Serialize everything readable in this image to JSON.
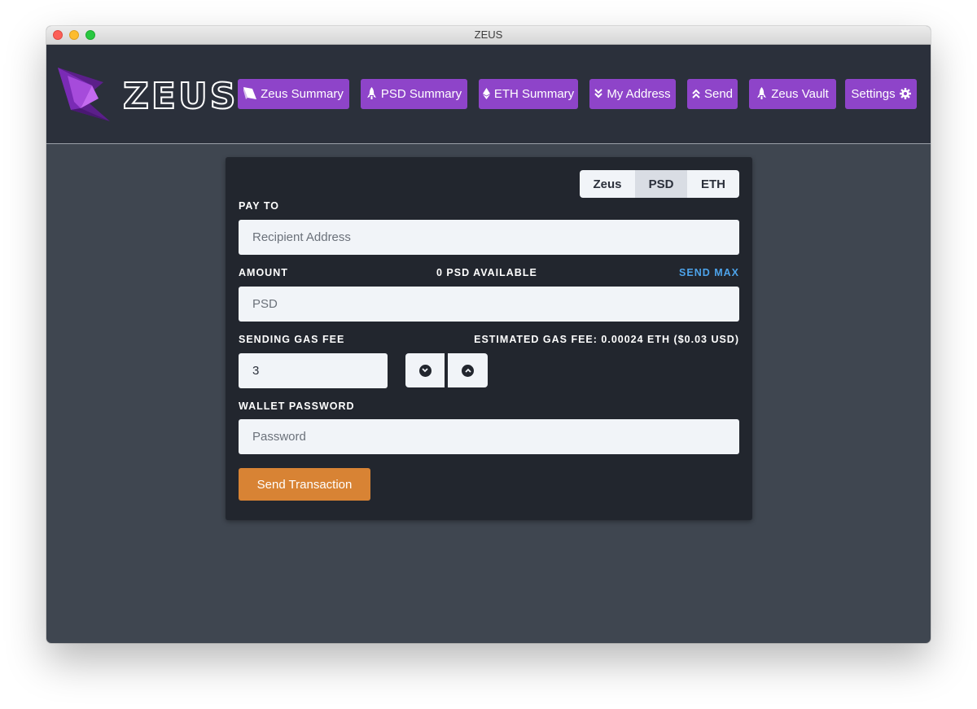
{
  "window": {
    "title": "ZEUS"
  },
  "logo": {
    "text": "ZEUS"
  },
  "nav": {
    "items": [
      {
        "label": "Zeus Summary",
        "icon": "eraser-icon"
      },
      {
        "label": "PSD Summary",
        "icon": "rocket-icon"
      },
      {
        "label": "ETH Summary",
        "icon": "ethereum-icon"
      },
      {
        "label": "My Address",
        "icon": "double-chevron-down-icon"
      },
      {
        "label": "Send",
        "icon": "double-chevron-up-icon"
      },
      {
        "label": "Zeus Vault",
        "icon": "rocket-icon"
      },
      {
        "label": "Settings",
        "icon": "gear-icon"
      }
    ]
  },
  "currency_tabs": {
    "items": [
      "Zeus",
      "PSD",
      "ETH"
    ],
    "active": "PSD"
  },
  "form": {
    "pay_to_label": "PAY TO",
    "recipient_placeholder": "Recipient Address",
    "amount_label": "AMOUNT",
    "available": "0 PSD AVAILABLE",
    "send_max": "SEND MAX",
    "amount_placeholder": "PSD",
    "gas_label": "SENDING GAS FEE",
    "estimated_gas": "ESTIMATED GAS FEE: 0.00024 ETH ($0.03 USD)",
    "gas_value": "3",
    "password_label": "WALLET PASSWORD",
    "password_placeholder": "Password",
    "submit_label": "Send Transaction"
  },
  "colors": {
    "accent": "#8e44c9",
    "submit": "#d88334",
    "link": "#4da3ea",
    "header_bg": "#2b303b",
    "card_bg": "#22262e",
    "page_bg": "#3f4650"
  }
}
